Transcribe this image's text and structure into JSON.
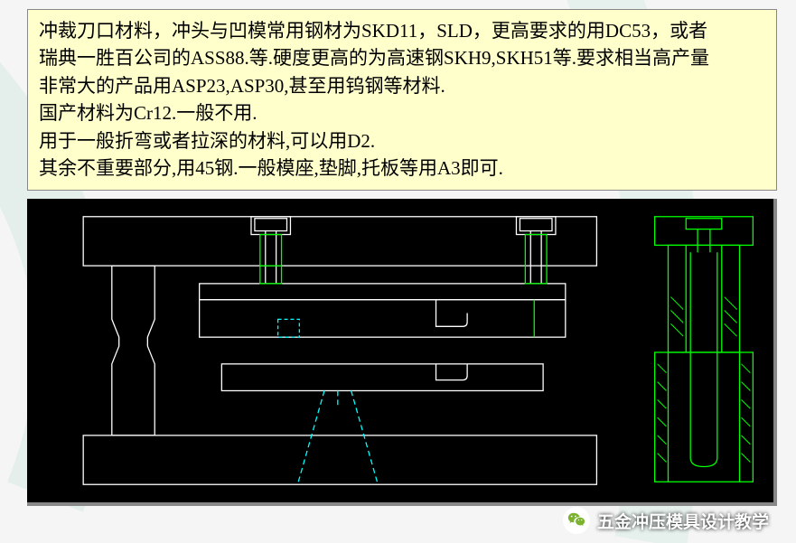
{
  "textbox": {
    "line1": "冲裁刀口材料，冲头与凹模常用钢材为SKD11，SLD，更高要求的用DC53，或者",
    "line2": "瑞典一胜百公司的ASS88.等.硬度更高的为高速钢SKH9,SKH51等.要求相当高产量",
    "line3": "非常大的产品用ASP23,ASP30,甚至用钨钢等材料.",
    "line4": " 国产材料为Cr12.一般不用.",
    "line5": " 用于一般折弯或者拉深的材料,可以用D2.",
    "line6": "其余不重要部分,用45钢.一般模座,垫脚,托板等用A3即可."
  },
  "diagram": {
    "description": "CAD cross-section of stamping die assembly",
    "layers": {
      "outline_white": "die plates and base structure",
      "green": "guide posts, bushings, punch components",
      "cyan_dashed": "hidden/center lines for bend relief"
    }
  },
  "attribution": {
    "platform_icon": "wechat-icon",
    "text": "五金冲压模具设计教学"
  },
  "colors": {
    "textbox_bg": "#ffffcc",
    "cad_bg": "#000000",
    "white_line": "#ffffff",
    "green_line": "#00ff00",
    "cyan_line": "#00ffff"
  }
}
